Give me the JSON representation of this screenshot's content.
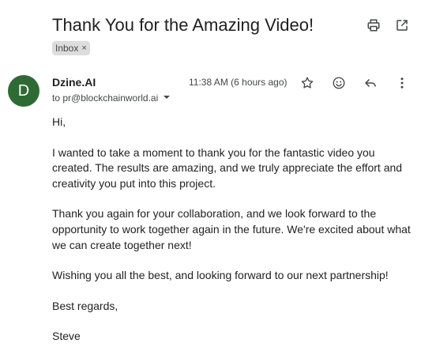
{
  "email": {
    "subject": "Thank You for the Amazing Video!",
    "label": "Inbox",
    "label_close": "×",
    "sender": {
      "initial": "D",
      "name": "Dzine.AI",
      "to": "to pr@blockchainworld.ai",
      "avatar_color": "#2e6b34"
    },
    "timestamp": "11:38 AM (6 hours ago)",
    "body": {
      "greeting": "Hi,",
      "paragraph1": "I wanted to take a moment to thank you for the fantastic video you created. The results are amazing, and we truly appreciate the effort and creativity you put into this project.",
      "paragraph2": "Thank you again for your collaboration, and we look forward to the opportunity to work together again in the future. We're excited about what we can create together next!",
      "paragraph3": "Wishing you all the best, and looking forward to our next partnership!",
      "closing": "Best regards,",
      "signature": "Steve"
    }
  },
  "icons": {
    "print": "print-icon",
    "open_new_window": "open-in-new-icon",
    "star": "star-icon",
    "emoji": "emoji-icon",
    "reply": "reply-icon",
    "more": "more-vert-icon",
    "recipient_details": "chevron-down-icon"
  }
}
